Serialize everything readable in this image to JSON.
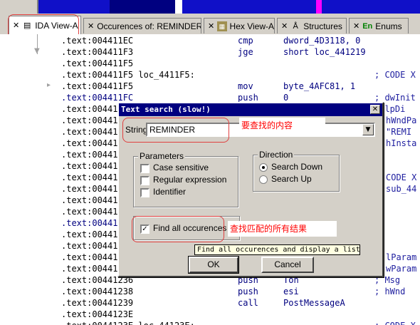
{
  "navigation_band": {
    "colors": {
      "base": "#1010c8",
      "dark": "#000080",
      "highlight": "#ffffff",
      "accent": "#ff00ff",
      "marker": "#808080"
    }
  },
  "tabs": [
    {
      "label": "IDA View-A",
      "icon": "document-icon",
      "active": true
    },
    {
      "label": "Occurences of: REMINDER",
      "icon": "none",
      "active": false
    },
    {
      "label": "Hex View-A",
      "icon": "hex-icon",
      "active": false
    },
    {
      "label": "Structures",
      "icon": "structures-icon",
      "active": false
    },
    {
      "label": "Enums",
      "icon": "En",
      "active": false
    }
  ],
  "code": {
    "lines": [
      {
        "addr": ".text:004411EC",
        "mnem": "cmp",
        "ops": "dword_4D3118, 0",
        "comment": ""
      },
      {
        "addr": ".text:004411F3",
        "mnem": "jge",
        "ops": "short loc_441219",
        "comment": ""
      },
      {
        "addr": ".text:004411F5",
        "mnem": "",
        "ops": "",
        "comment": ""
      },
      {
        "addr": ".text:004411F5 loc_4411F5:",
        "mnem": "",
        "ops": "",
        "comment": "; CODE X"
      },
      {
        "addr": ".text:004411F5",
        "mnem": "mov",
        "ops": "byte_4AFC81, 1",
        "comment": ""
      },
      {
        "addr": ".text:004411FC",
        "mnem": "push",
        "ops": "0",
        "comment": "; dwInit"
      },
      {
        "addr": ".text:004411FE",
        "mnem": "",
        "ops": "",
        "comment": "; lpDi"
      },
      {
        "addr": ".text:00441",
        "mnem": "",
        "ops": "",
        "comment": "hWndPa"
      },
      {
        "addr": ".text:00441",
        "mnem": "",
        "ops": "",
        "comment": "\"REMI"
      },
      {
        "addr": ".text:00441",
        "mnem": "",
        "ops": "",
        "comment": "hInsta"
      },
      {
        "addr": ".text:00441",
        "mnem": "",
        "ops": "",
        "comment": ""
      },
      {
        "addr": ".text:00441",
        "mnem": "",
        "ops": "",
        "comment": ""
      },
      {
        "addr": ".text:00441",
        "mnem": "",
        "ops": "",
        "comment": "CODE X"
      },
      {
        "addr": ".text:00441",
        "mnem": "",
        "ops": "",
        "comment": "sub_44"
      },
      {
        "addr": ".text:00441",
        "mnem": "",
        "ops": "",
        "comment": ""
      },
      {
        "addr": ".text:00441",
        "mnem": "",
        "ops": "",
        "comment": ""
      },
      {
        "addr": ".text:00441",
        "mnem": "",
        "ops": "",
        "comment": ""
      },
      {
        "addr": ".text:00441",
        "mnem": "",
        "ops": "",
        "comment": ""
      },
      {
        "addr": ".text:00441",
        "mnem": "",
        "ops": "",
        "comment": ""
      },
      {
        "addr": ".text:00441",
        "mnem": "",
        "ops": "",
        "comment": "lParam"
      },
      {
        "addr": ".text:00441",
        "mnem": "",
        "ops": "",
        "comment": "wParam"
      },
      {
        "addr": ".text:00441236",
        "mnem": "push",
        "ops": "Toh",
        "comment": "; Msg"
      },
      {
        "addr": ".text:00441238",
        "mnem": "push",
        "ops": "esi",
        "comment": "; hWnd"
      },
      {
        "addr": ".text:00441239",
        "mnem": "call",
        "ops": "PostMessageA",
        "comment": ""
      },
      {
        "addr": ".text:0044123E",
        "mnem": "",
        "ops": "",
        "comment": ""
      },
      {
        "addr": ".text:0044123E loc_44123E:",
        "mnem": "",
        "ops": "",
        "comment": "; CODE X"
      }
    ]
  },
  "dialog": {
    "title": "Text search (slow!)",
    "close_glyph": "✕",
    "string_label": "String",
    "string_value": "REMINDER",
    "parameters_title": "Parameters",
    "case_sensitive": "Case sensitive",
    "regex": "Regular expression",
    "identifier": "Identifier",
    "direction_title": "Direction",
    "search_down": "Search Down",
    "search_up": "Search Up",
    "find_all": "Find all occurences",
    "find_all_checked": true,
    "ok_label": "OK",
    "cancel_label": "Cancel",
    "tooltip": "Find all occurences and display a list"
  },
  "annotations": {
    "content_note": "要查找的内容",
    "find_all_note": "查找匹配的所有结果",
    "color": "#ff0000"
  }
}
